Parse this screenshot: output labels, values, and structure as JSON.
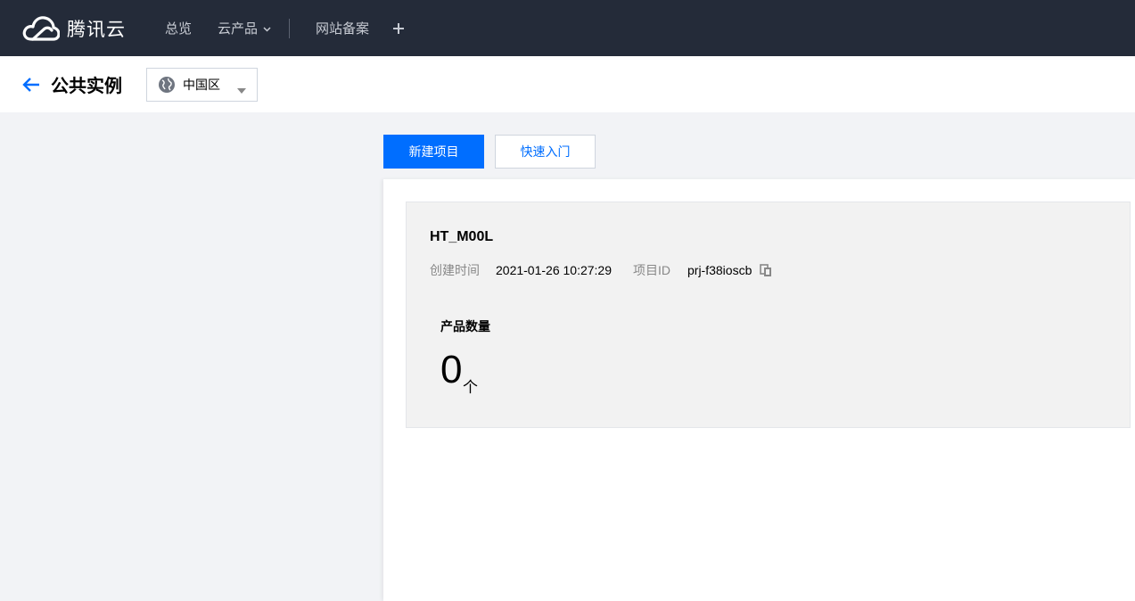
{
  "topnav": {
    "brand": "腾讯云",
    "items": [
      "总览",
      "云产品",
      "网站备案"
    ],
    "icons": [
      "tencent-cloud-logo",
      "chevron-down-icon",
      "plus-icon"
    ],
    "background": "#242b39"
  },
  "subheader": {
    "title": "公共实例",
    "region": "中国区",
    "icons": [
      "back-arrow-icon",
      "globe-icon",
      "caret-down-icon"
    ]
  },
  "actions": {
    "new_project": "新建项目",
    "quick_start": "快速入门",
    "accent": "#006eff"
  },
  "project": {
    "name": "HT_M00L",
    "created_label": "创建时间",
    "created_value": "2021-01-26 10:27:29",
    "id_label": "项目ID",
    "id_value": "prj-f38ioscb",
    "product_count_label": "产品数量",
    "product_count": "0",
    "product_count_unit": "个"
  }
}
